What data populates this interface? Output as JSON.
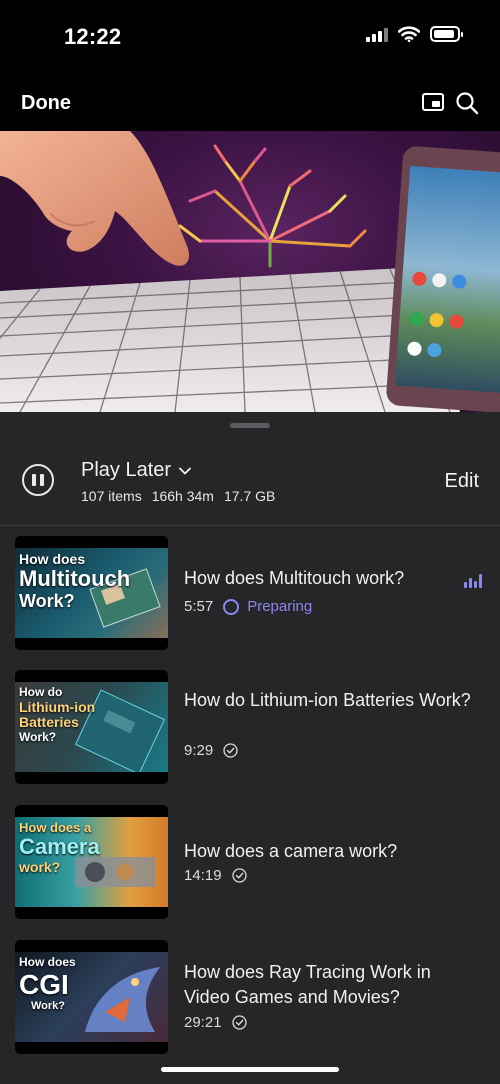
{
  "status_bar": {
    "time": "12:22"
  },
  "top_bar": {
    "done_label": "Done"
  },
  "playlist": {
    "title": "Play Later",
    "items_count": "107 items",
    "duration": "166h 34m",
    "size": "17.7 GB",
    "edit_label": "Edit"
  },
  "videos": [
    {
      "title": "How does Multitouch work?",
      "duration": "5:57",
      "status": "Preparing",
      "thumb_lines": [
        "How does",
        "Multitouch",
        "Work?"
      ]
    },
    {
      "title": "How do Lithium-ion Batteries Work?",
      "duration": "9:29",
      "status": "downloaded",
      "thumb_lines": [
        "How do",
        "Lithium-ion",
        "Batteries",
        "Work?"
      ]
    },
    {
      "title": "How does a camera work?",
      "duration": "14:19",
      "status": "downloaded",
      "thumb_lines": [
        "How does a",
        "Camera",
        "work?"
      ]
    },
    {
      "title": "How does Ray Tracing Work in Video Games and Movies?",
      "duration": "29:21",
      "status": "downloaded",
      "thumb_lines": [
        "How does",
        "CGI",
        "Work?"
      ]
    }
  ],
  "colors": {
    "accent": "#8a86f3",
    "sheet": "#262527"
  },
  "icons": [
    "signal-icon",
    "wifi-icon",
    "battery-icon",
    "picture-in-picture-icon",
    "search-icon",
    "pause-icon",
    "chevron-down-icon",
    "check-circle-icon",
    "now-playing-icon"
  ]
}
